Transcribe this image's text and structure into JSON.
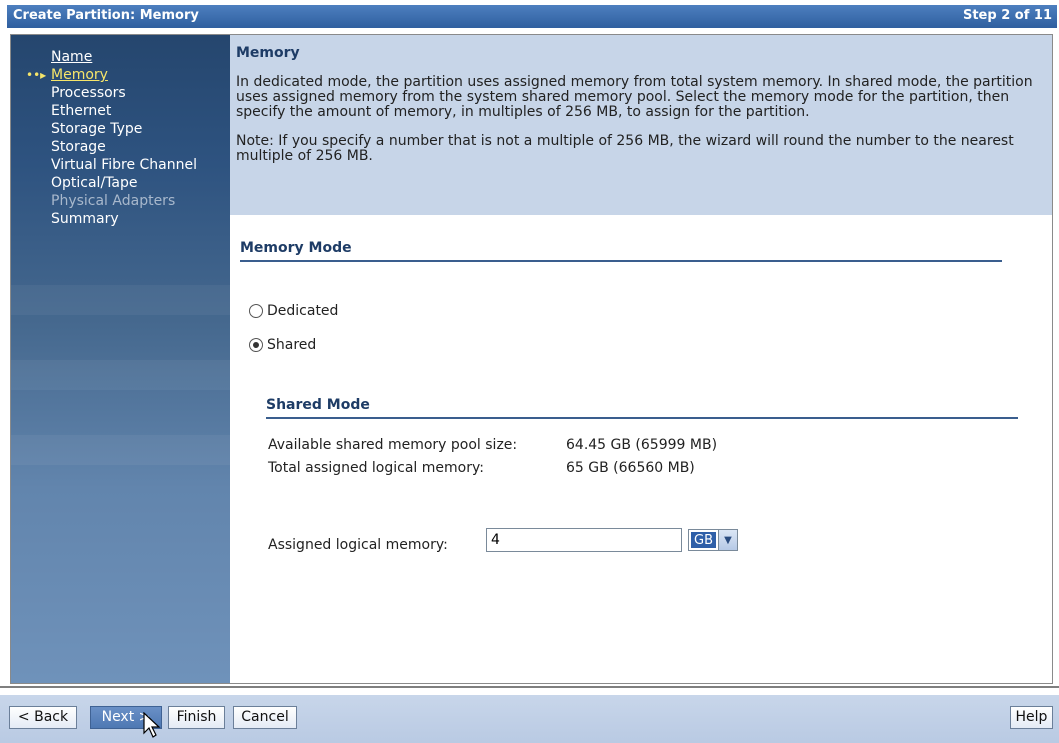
{
  "window": {
    "title": "Create Partition: Memory",
    "step": "Step 2 of 11"
  },
  "sidebar": {
    "items": [
      {
        "label": "Name",
        "state": "link"
      },
      {
        "label": "Memory",
        "state": "current"
      },
      {
        "label": "Processors",
        "state": "normal"
      },
      {
        "label": "Ethernet",
        "state": "normal"
      },
      {
        "label": "Storage Type",
        "state": "normal"
      },
      {
        "label": "Storage",
        "state": "normal"
      },
      {
        "label": "Virtual Fibre Channel",
        "state": "normal"
      },
      {
        "label": "Optical/Tape",
        "state": "normal"
      },
      {
        "label": "Physical Adapters",
        "state": "disabled"
      },
      {
        "label": "Summary",
        "state": "normal"
      }
    ]
  },
  "intro": {
    "title": "Memory",
    "paragraph": "In dedicated mode, the partition uses assigned memory from total system memory. In shared mode, the partition uses assigned memory from the system shared memory pool. Select the memory mode for the partition, then specify the amount of memory, in multiples of 256 MB, to assign for the partition.",
    "note": "Note: If you specify a number that is not a multiple of 256 MB, the wizard will round the number to the nearest multiple of 256 MB."
  },
  "memory_mode": {
    "title": "Memory Mode",
    "options": [
      {
        "label": "Dedicated",
        "selected": false
      },
      {
        "label": "Shared",
        "selected": true
      }
    ]
  },
  "shared_mode": {
    "title": "Shared Mode",
    "pool_label": "Available shared memory pool size:",
    "pool_value": "64.45 GB (65999 MB)",
    "total_label": "Total assigned logical memory:",
    "total_value": "65 GB (66560 MB)",
    "assigned_label": "Assigned logical memory:",
    "assigned_value": "4",
    "unit": "GB"
  },
  "buttons": {
    "back": "< Back",
    "next": "Next >",
    "finish": "Finish",
    "cancel": "Cancel",
    "help": "Help"
  },
  "colors": {
    "title_bar": "#3a6aaa",
    "sidebar_top": "#25466e",
    "intro_bg": "#c7d5e8",
    "current_nav": "#f6e56a"
  }
}
